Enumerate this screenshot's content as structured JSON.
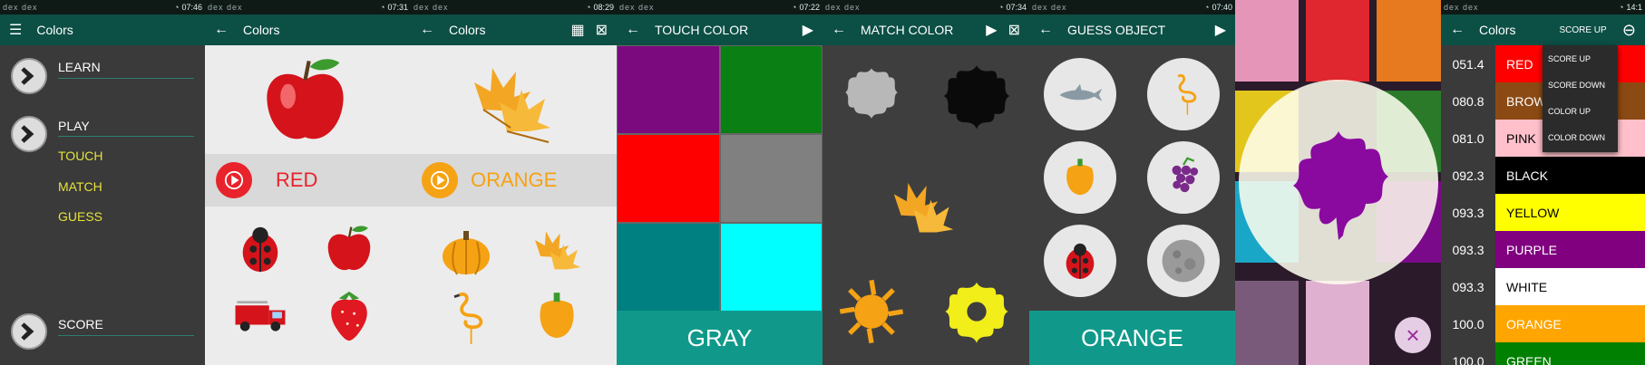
{
  "status_bars": [
    {
      "left": "dex dex",
      "time": "07:46"
    },
    {
      "left": "dex dex",
      "time": "07:31"
    },
    {
      "left": "dex dex",
      "time": "08:29"
    },
    {
      "left": "dex dex",
      "time": "07:22"
    },
    {
      "left": "dex dex",
      "time": "07:34"
    },
    {
      "left": "dex dex",
      "time": "07:40"
    },
    {
      "left": "",
      "time": ""
    },
    {
      "left": "dex dex",
      "time": "14:1"
    }
  ],
  "main_menu": {
    "title": "Colors",
    "learn": "LEARN",
    "play": "PLAY",
    "touch": "TOUCH",
    "match": "MATCH",
    "guess": "GUESS",
    "score": "SCORE"
  },
  "learn_red": {
    "title": "Colors",
    "color_name": "RED",
    "color_hex": "#e8232b"
  },
  "learn_orange": {
    "title": "Colors",
    "color_name": "ORANGE",
    "color_hex": "#f5a214"
  },
  "touch_color": {
    "title": "TOUCH COLOR",
    "tiles": [
      "#7b0a7e",
      "#0a7f13",
      "#ff0000",
      "#808080",
      "#008080",
      "#00ffff"
    ],
    "answer": "GRAY"
  },
  "match_color": {
    "title": "MATCH COLOR"
  },
  "guess_object": {
    "title": "GUESS OBJECT",
    "answer": "ORANGE"
  },
  "splash_overlay": {
    "color": "#8a0aa0"
  },
  "score_list": {
    "title": "Colors",
    "sort_label": "SCORE UP",
    "menu": [
      "SCORE UP",
      "SCORE DOWN",
      "COLOR UP",
      "COLOR DOWN"
    ],
    "rows": [
      {
        "score": "051.4",
        "name": "RED",
        "bg": "#ff0000",
        "fg": "#ffffff"
      },
      {
        "score": "080.8",
        "name": "BROWN",
        "bg": "#8b4a14",
        "fg": "#ffffff"
      },
      {
        "score": "081.0",
        "name": "PINK",
        "bg": "#ffc0cb",
        "fg": "#000000"
      },
      {
        "score": "092.3",
        "name": "BLACK",
        "bg": "#000000",
        "fg": "#ffffff"
      },
      {
        "score": "093.3",
        "name": "YELLOW",
        "bg": "#ffff00",
        "fg": "#000000"
      },
      {
        "score": "093.3",
        "name": "PURPLE",
        "bg": "#800080",
        "fg": "#ffffff"
      },
      {
        "score": "093.3",
        "name": "WHITE",
        "bg": "#ffffff",
        "fg": "#000000"
      },
      {
        "score": "100.0",
        "name": "ORANGE",
        "bg": "#ffa500",
        "fg": "#ffffff"
      },
      {
        "score": "100.0",
        "name": "GREEN",
        "bg": "#008000",
        "fg": "#ffffff"
      }
    ]
  }
}
